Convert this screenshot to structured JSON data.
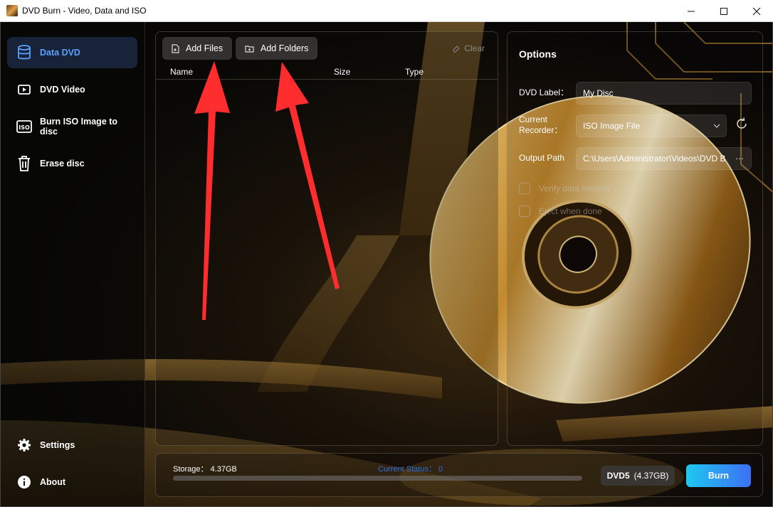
{
  "window": {
    "title": "DVD Burn - Video, Data and ISO"
  },
  "sidebar": {
    "items": [
      {
        "label": "Data DVD",
        "icon": "database-icon",
        "active": true
      },
      {
        "label": "DVD Video",
        "icon": "video-icon",
        "active": false
      },
      {
        "label": "Burn ISO Image to disc",
        "icon": "iso-icon",
        "active": false
      },
      {
        "label": "Erase disc",
        "icon": "trash-icon",
        "active": false
      }
    ],
    "bottom": [
      {
        "label": "Settings",
        "icon": "gear-icon"
      },
      {
        "label": "About",
        "icon": "info-icon"
      }
    ]
  },
  "file_panel": {
    "add_files_label": "Add Files",
    "add_folders_label": "Add Folders",
    "clear_label": "Clear",
    "columns": [
      "Name",
      "Size",
      "Type"
    ],
    "rows": []
  },
  "options": {
    "title": "Options",
    "dvd_label_label": "DVD Label：",
    "dvd_label_value": "My Disc",
    "recorder_label_line1": "Current",
    "recorder_label_line2": "Recorder：",
    "recorder_value": "ISO Image File",
    "output_path_label": "Output Path",
    "output_path_value": "C:\\Users\\Administrator\\Videos\\DVD B",
    "verify_label": "Verify data integrity",
    "eject_label": "Eject when done"
  },
  "status": {
    "storage_label": "Storage： 4.37GB",
    "current_status_label": "Current Status： 0",
    "progress_fraction": 0,
    "disc_type": "DVD5",
    "disc_capacity": "(4.37GB)",
    "burn_label": "Burn"
  },
  "colors": {
    "accent": "#3b82f6",
    "active_nav_bg": "#18233a",
    "burn_gradient_start": "#1ec8f0",
    "burn_gradient_end": "#3d6ff5",
    "annotation_arrow": "#ff2d2d"
  }
}
